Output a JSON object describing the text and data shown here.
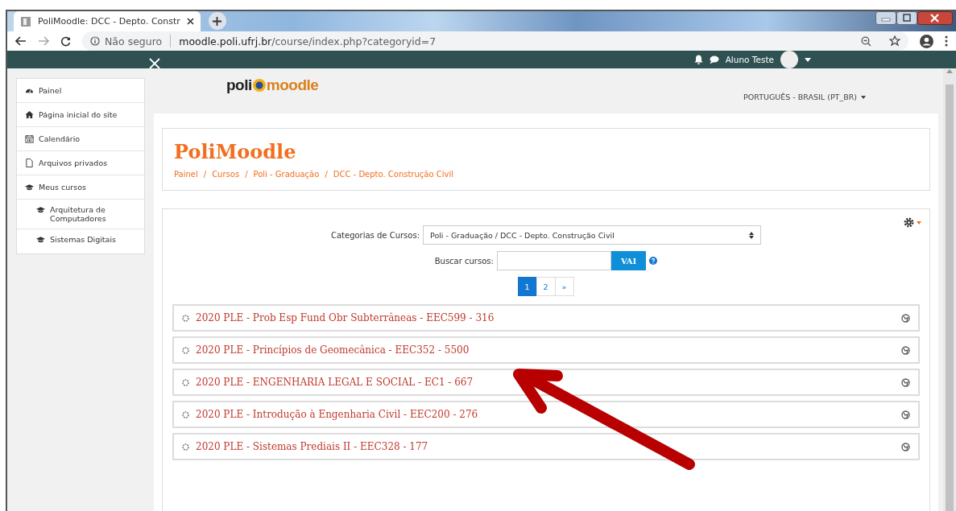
{
  "browser": {
    "tab_title": "PoliMoodle: DCC - Depto. Constr",
    "security": "Não seguro",
    "url_host": "moodle.poli.ufrj.br",
    "url_path": "/course/index.php?categoryid=7"
  },
  "navbar": {
    "user_name": "Aluno Teste"
  },
  "logo": {
    "part1": "poli",
    "part2": "moodle"
  },
  "language": "PORTUGUÊS - BRASIL (PT_BR)",
  "sidebar": {
    "items": [
      {
        "label": "Painel",
        "kind": "dashboard"
      },
      {
        "label": "Página inicial do site",
        "kind": "home"
      },
      {
        "label": "Calendário",
        "kind": "calendar"
      },
      {
        "label": "Arquivos privados",
        "kind": "file"
      },
      {
        "label": "Meus cursos",
        "kind": "courses",
        "children": [
          {
            "label": "Arquitetura de Computadores",
            "kind": "courses"
          },
          {
            "label": "Sistemas Digitais",
            "kind": "courses"
          }
        ]
      }
    ]
  },
  "page_header": {
    "title": "PoliMoodle",
    "breadcrumb_separator": "/",
    "breadcrumb": [
      "Painel",
      "Cursos",
      "Poli - Graduação",
      "DCC - Depto. Construção Civil"
    ]
  },
  "course_box": {
    "category_label": "Categorias de Cursos:",
    "category_value": "Poli - Graduação / DCC - Depto. Construção Civil",
    "search_label": "Buscar cursos:",
    "search_button": "VAI",
    "pages": [
      {
        "label": "1",
        "selected": true
      },
      {
        "label": "2",
        "selected": false
      },
      {
        "label": "»",
        "selected": false
      }
    ],
    "courses": [
      "2020 PLE - Prob Esp Fund Obr Subterrâneas - EEC599 - 316",
      "2020 PLE - Princípios de Geomecânica - EEC352 - 5500",
      "2020 PLE - ENGENHARIA LEGAL E SOCIAL - EC1 - 667",
      "2020 PLE - Introdução à Engenharia Civil - EEC200 - 276",
      "2020 PLE - Sistemas Prediais II - EEC328 - 177"
    ]
  }
}
